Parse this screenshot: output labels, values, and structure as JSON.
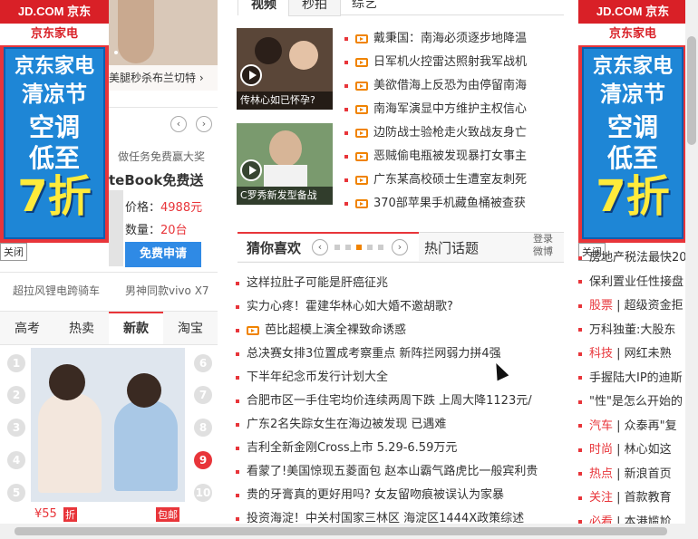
{
  "ad_left": {
    "top": "JD.COM 京东",
    "brand": "京东家电",
    "line1": "京东家电",
    "line2": "清凉节",
    "line3": "空调",
    "line4": "低至",
    "line5": "7折",
    "close": "关闭"
  },
  "ad_right": {
    "top": "JD.COM 京东",
    "brand": "京东家电",
    "line1": "京东家电",
    "line2": "清凉节",
    "line3": "空调",
    "line4": "低至",
    "line5": "7折",
    "close": "关闭"
  },
  "left_col": {
    "caption": "美腿秒杀布兰切特",
    "task_label": "做任务免费赢大奖",
    "product_name": "teBook免费送",
    "price_label": "价格：",
    "price_value": "4988元",
    "qty_label": "数量：",
    "qty_value": "20台",
    "apply_btn": "免费申请",
    "link1": "超拉风锂电跨骑车",
    "link2": "男神同款vivo X7",
    "tabs": [
      "高考",
      "热卖",
      "新款",
      "淘宝"
    ],
    "ranks_left": [
      "1",
      "2",
      "3",
      "4",
      "5"
    ],
    "ranks_right": [
      "6",
      "7",
      "8",
      "9",
      "10"
    ],
    "price_tag": "¥55",
    "tag_fold": "折",
    "tag_free": "包邮"
  },
  "middle": {
    "tabs_top": [
      "视频",
      "秒拍",
      "综艺"
    ],
    "thumb1_caption": "传林心如已怀孕?",
    "thumb2_caption": "C罗秀新发型备战",
    "video_news": [
      "戴秉国：南海必须逐步地降温",
      "日军机火控雷达照射我军战机",
      "美欲借海上反恐为由停留南海",
      "南海军演显中方维护主权信心",
      "边防战士验枪走火致战友身亡",
      "恶贼偷电瓶被发现暴打女事主",
      "广东某高校硕士生遭室友刺死",
      "370部苹果手机藏鱼桶被查获"
    ],
    "guess_title": "猜你喜欢",
    "hot_title": "热门话题",
    "login_weibo_1": "登录",
    "login_weibo_2": "微博",
    "news": [
      {
        "text": "这样拉肚子可能是肝癌征兆",
        "icon": "dot"
      },
      {
        "text": "实力心疼！霍建华林心如大婚不邀胡歌?",
        "icon": "dot"
      },
      {
        "text": "芭比超模上演全裸致命诱惑",
        "icon": "video"
      },
      {
        "text": "总决赛女排3位置成考察重点 新阵拦网弱力拼4强",
        "icon": "dot"
      },
      {
        "text": "下半年纪念币发行计划大全",
        "icon": "dot"
      },
      {
        "text": "合肥市区一手住宅均价连续两周下跌 上周大降1123元/",
        "icon": "dot"
      },
      {
        "text": "广东2名失踪女生在海边被发现 已遇难",
        "icon": "dot"
      },
      {
        "text": "吉利全新金刚Cross上市 5.29-6.59万元",
        "icon": "dot"
      },
      {
        "text": "看蒙了!美国惊现五菱面包 赵本山霸气路虎比一般宾利贵",
        "icon": "dot"
      },
      {
        "text": "贵的牙膏真的更好用吗? 女友留吻痕被误认为家暴",
        "icon": "dot"
      },
      {
        "text": "投资海淀！中关村国家三林区 海淀区1444X政策综述",
        "icon": "dot"
      }
    ]
  },
  "right_col": {
    "items": [
      {
        "cat": "",
        "text": "房地产税法最快20"
      },
      {
        "cat": "",
        "text": "保利置业任性接盘"
      },
      {
        "cat": "股票",
        "text": "超级资金拒"
      },
      {
        "cat": "",
        "text": "万科独董:大股东"
      },
      {
        "cat": "科技",
        "text": "网红未熟"
      },
      {
        "cat": "",
        "text": "手握陆大IP的迪斯"
      },
      {
        "cat": "",
        "text": "\"性\"是怎么开始的"
      },
      {
        "cat": "汽车",
        "text": "众泰再\"复"
      },
      {
        "cat": "时尚",
        "text": "林心如这"
      },
      {
        "cat": "热点",
        "text": "新浪首页"
      },
      {
        "cat": "关注",
        "text": "首款教育"
      },
      {
        "cat": "必看",
        "text": "本港尴尬"
      }
    ]
  }
}
